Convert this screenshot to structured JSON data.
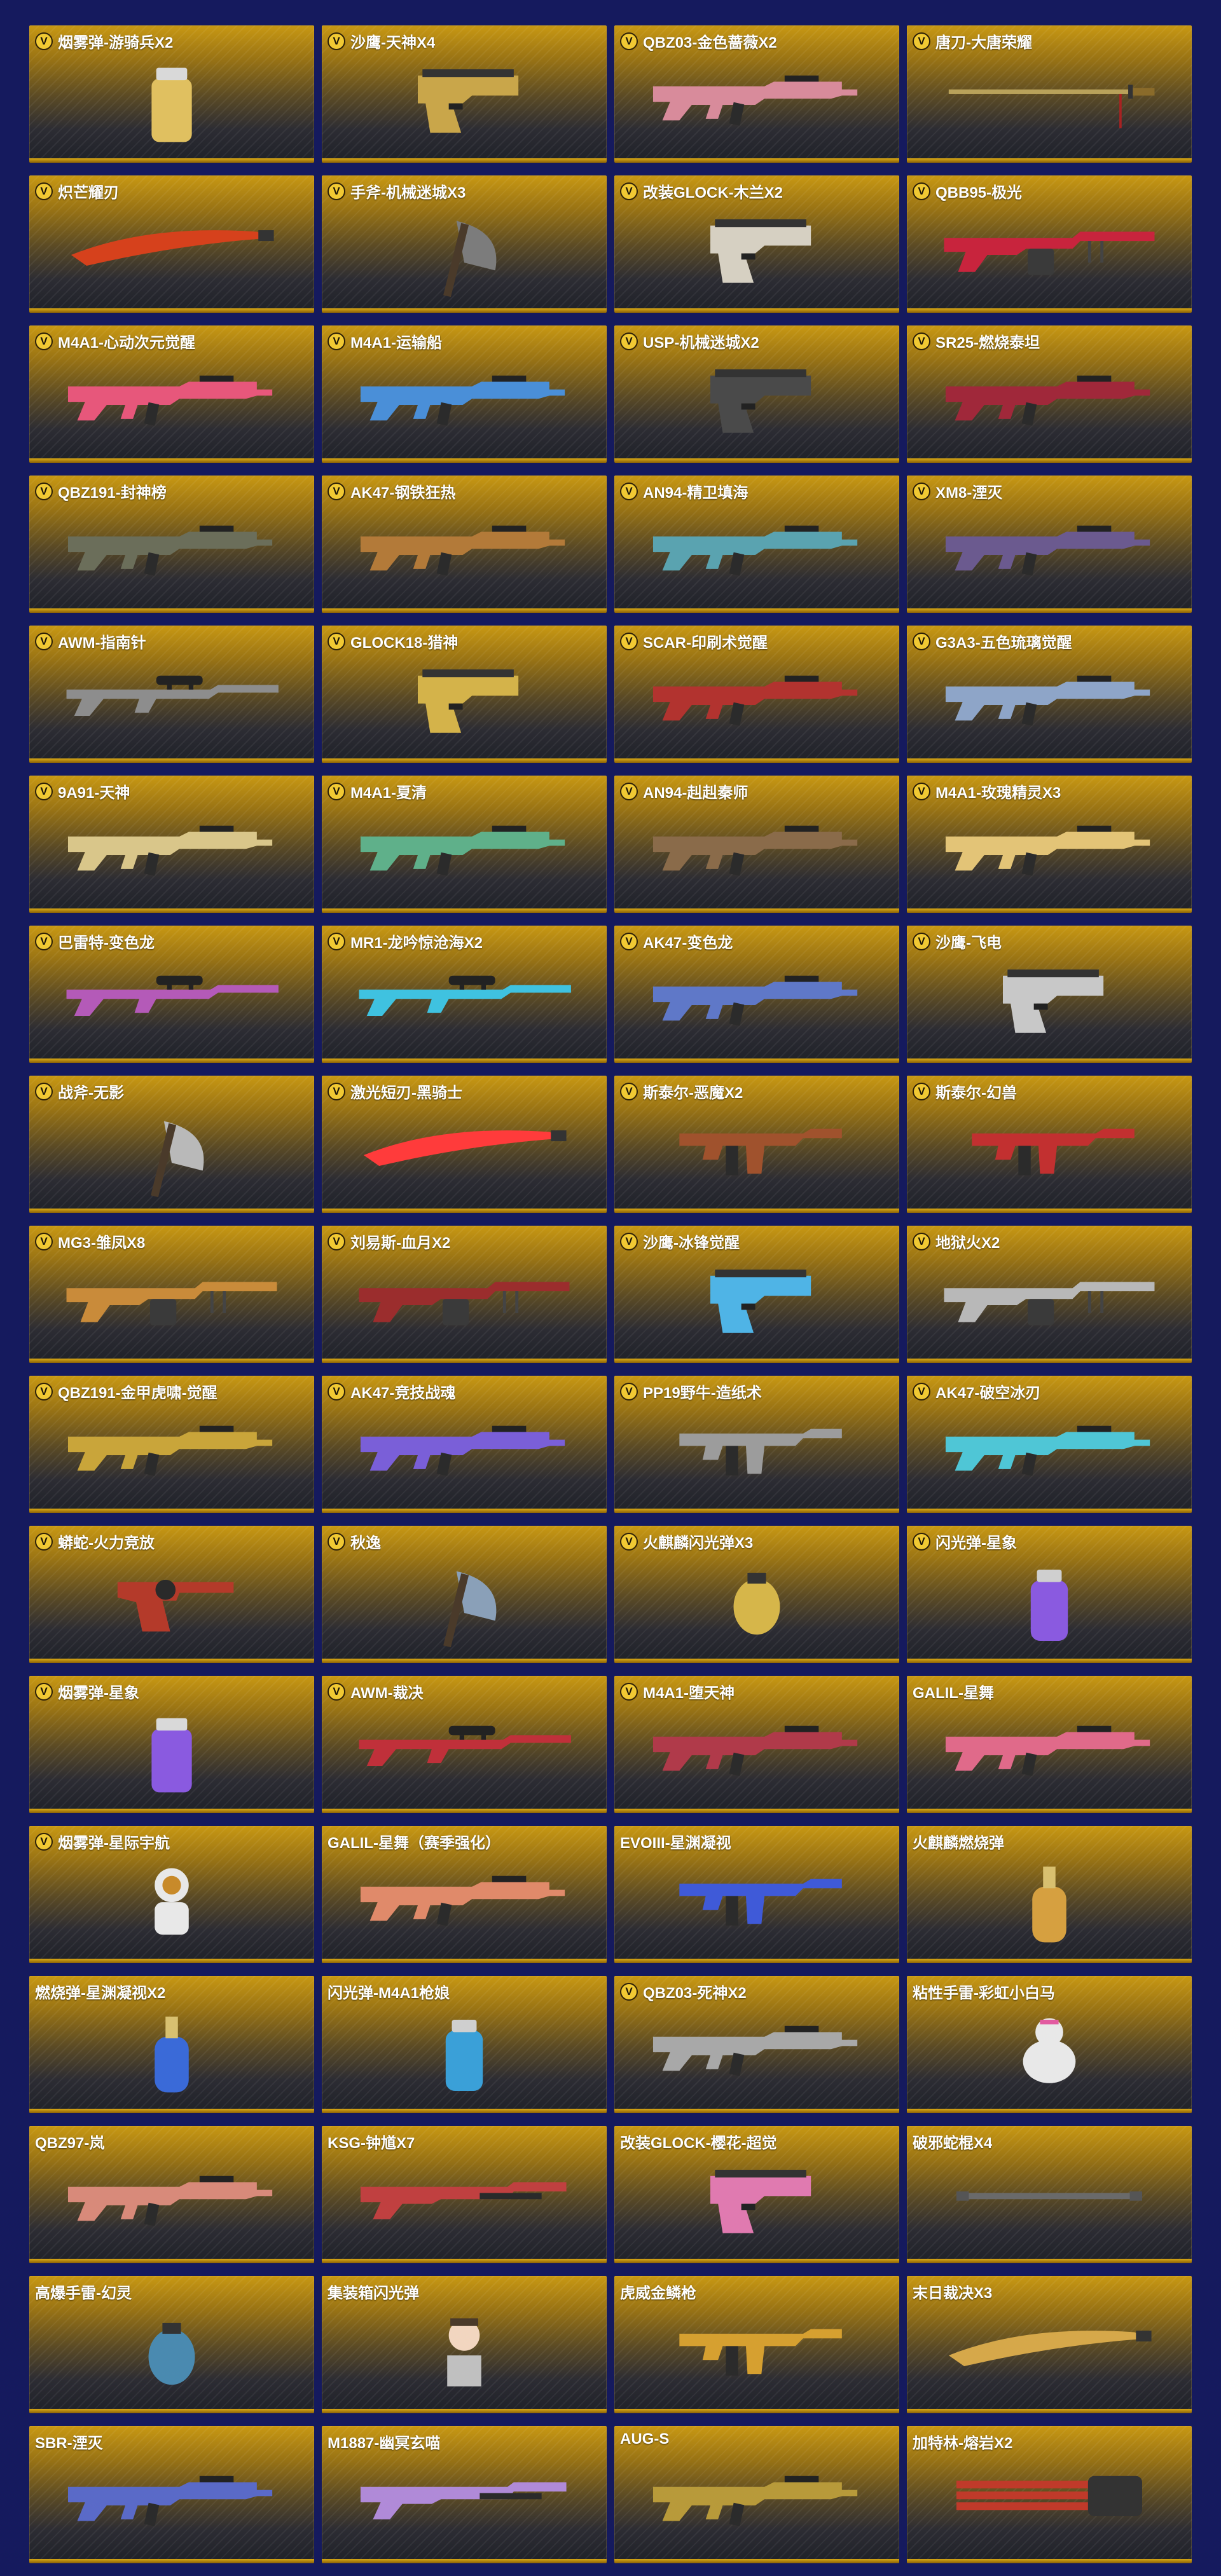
{
  "colors": {
    "page_background": "#151a5e",
    "card_gold": "#c89813",
    "card_dark": "#1f2128",
    "badge": "#f1c933"
  },
  "badge_letter": "V",
  "items": [
    {
      "name": "烟雾弹-游骑兵X2",
      "vip": true,
      "icon": "smoke-grenade",
      "color": "#e0c060"
    },
    {
      "name": "沙鹰-天神X4",
      "vip": true,
      "icon": "pistol",
      "color": "#c9a64a"
    },
    {
      "name": "QBZ03-金色蔷薇X2",
      "vip": true,
      "icon": "rifle",
      "color": "#d88b9b"
    },
    {
      "name": "唐刀-大唐荣耀",
      "vip": true,
      "icon": "sword",
      "color": "#b9a25a"
    },
    {
      "name": "炽芒耀刃",
      "vip": true,
      "icon": "blade",
      "color": "#d6411c"
    },
    {
      "name": "手斧-机械迷城X3",
      "vip": true,
      "icon": "axe",
      "color": "#7c7c7c"
    },
    {
      "name": "改装GLOCK-木兰X2",
      "vip": true,
      "icon": "pistol",
      "color": "#d6d0c2"
    },
    {
      "name": "QBB95-极光",
      "vip": true,
      "icon": "machinegun",
      "color": "#c8243d"
    },
    {
      "name": "M4A1-心动次元觉醒",
      "vip": true,
      "icon": "rifle",
      "color": "#e7577b"
    },
    {
      "name": "M4A1-运输船",
      "vip": true,
      "icon": "rifle",
      "color": "#4a8fd8"
    },
    {
      "name": "USP-机械迷城X2",
      "vip": true,
      "icon": "pistol",
      "color": "#4a4a4a"
    },
    {
      "name": "SR25-燃烧泰坦",
      "vip": true,
      "icon": "rifle",
      "color": "#a0283a"
    },
    {
      "name": "QBZ191-封神榜",
      "vip": true,
      "icon": "rifle",
      "color": "#6b6e5a"
    },
    {
      "name": "AK47-钢铁狂热",
      "vip": true,
      "icon": "rifle",
      "color": "#b37a39"
    },
    {
      "name": "AN94-精卫填海",
      "vip": true,
      "icon": "rifle",
      "color": "#5aa3b0"
    },
    {
      "name": "XM8-湮灭",
      "vip": true,
      "icon": "rifle",
      "color": "#6b5a8f"
    },
    {
      "name": "AWM-指南针",
      "vip": true,
      "icon": "sniper",
      "color": "#8d8d8d"
    },
    {
      "name": "GLOCK18-猎神",
      "vip": true,
      "icon": "pistol",
      "color": "#d4b34a"
    },
    {
      "name": "SCAR-印刷术觉醒",
      "vip": true,
      "icon": "rifle",
      "color": "#b2332f"
    },
    {
      "name": "G3A3-五色琉璃觉醒",
      "vip": true,
      "icon": "rifle",
      "color": "#8ea5c8"
    },
    {
      "name": "9A91-天神",
      "vip": true,
      "icon": "rifle",
      "color": "#d9c68a"
    },
    {
      "name": "M4A1-夏清",
      "vip": true,
      "icon": "rifle",
      "color": "#5fb08a"
    },
    {
      "name": "AN94-赳赳秦师",
      "vip": true,
      "icon": "rifle",
      "color": "#8a6b4a"
    },
    {
      "name": "M4A1-玫瑰精灵X3",
      "vip": true,
      "icon": "rifle",
      "color": "#e3c477"
    },
    {
      "name": "巴雷特-变色龙",
      "vip": true,
      "icon": "sniper",
      "color": "#b45ab8"
    },
    {
      "name": "MR1-龙吟惊沧海X2",
      "vip": true,
      "icon": "sniper",
      "color": "#3fc2e0"
    },
    {
      "name": "AK47-变色龙",
      "vip": true,
      "icon": "rifle",
      "color": "#5f78c8"
    },
    {
      "name": "沙鹰-飞电",
      "vip": true,
      "icon": "pistol",
      "color": "#c8c8c8"
    },
    {
      "name": "战斧-无影",
      "vip": true,
      "icon": "axe",
      "color": "#b9b9b9"
    },
    {
      "name": "激光短刃-黑骑士",
      "vip": true,
      "icon": "blade",
      "color": "#ff3b3b"
    },
    {
      "name": "斯泰尔-恶魔X2",
      "vip": true,
      "icon": "smg",
      "color": "#a0522d"
    },
    {
      "name": "斯泰尔-幻兽",
      "vip": true,
      "icon": "smg",
      "color": "#c23030"
    },
    {
      "name": "MG3-雏凤X8",
      "vip": true,
      "icon": "machinegun",
      "color": "#c98b3a"
    },
    {
      "name": "刘易斯-血月X2",
      "vip": true,
      "icon": "machinegun",
      "color": "#9b2d2d"
    },
    {
      "name": "沙鹰-冰锋觉醒",
      "vip": true,
      "icon": "pistol",
      "color": "#4fb4e6"
    },
    {
      "name": "地狱火X2",
      "vip": true,
      "icon": "machinegun",
      "color": "#b8b8b8"
    },
    {
      "name": "QBZ191-金甲虎啸-觉醒",
      "vip": true,
      "icon": "rifle",
      "color": "#c9a53a"
    },
    {
      "name": "AK47-竞技战魂",
      "vip": true,
      "icon": "rifle",
      "color": "#7a5fd8"
    },
    {
      "name": "PP19野牛-造纸术",
      "vip": true,
      "icon": "smg",
      "color": "#9c9c9c"
    },
    {
      "name": "AK47-破空冰刃",
      "vip": true,
      "icon": "rifle",
      "color": "#4fc6d6"
    },
    {
      "name": "蟒蛇-火力竞放",
      "vip": true,
      "icon": "revolver",
      "color": "#b43a2a"
    },
    {
      "name": "秋逸",
      "vip": true,
      "icon": "axe",
      "color": "#8aa0b8"
    },
    {
      "name": "火麒麟闪光弹X3",
      "vip": true,
      "icon": "grenade",
      "color": "#d6b64a"
    },
    {
      "name": "闪光弹-星象",
      "vip": true,
      "icon": "flash-grenade",
      "color": "#8a5ae0"
    },
    {
      "name": "烟雾弹-星象",
      "vip": true,
      "icon": "smoke-grenade",
      "color": "#8a5ae0"
    },
    {
      "name": "AWM-裁决",
      "vip": true,
      "icon": "sniper",
      "color": "#c0303a"
    },
    {
      "name": "M4A1-堕天神",
      "vip": true,
      "icon": "rifle",
      "color": "#b03a4a"
    },
    {
      "name": "GALIL-星舞",
      "vip": false,
      "icon": "rifle",
      "color": "#e06a8a"
    },
    {
      "name": "烟雾弹-星际宇航",
      "vip": true,
      "icon": "astronaut",
      "color": "#e8e8e8"
    },
    {
      "name": "GALIL-星舞（赛季强化）",
      "vip": false,
      "icon": "rifle",
      "color": "#e08a6a"
    },
    {
      "name": "EVOIII-星渊凝视",
      "vip": false,
      "icon": "smg",
      "color": "#3f5ad8"
    },
    {
      "name": "火麒麟燃烧弹",
      "vip": false,
      "icon": "molotov",
      "color": "#d6a040"
    },
    {
      "name": "燃烧弹-星渊凝视X2",
      "vip": false,
      "icon": "molotov",
      "color": "#3a6ad8"
    },
    {
      "name": "闪光弹-M4A1枪娘",
      "vip": false,
      "icon": "flash-grenade",
      "color": "#3aa0d8"
    },
    {
      "name": "QBZ03-死神X2",
      "vip": true,
      "icon": "rifle",
      "color": "#a8a8a8"
    },
    {
      "name": "粘性手雷-彩虹小白马",
      "vip": false,
      "icon": "mascot",
      "color": "#e8e8e8"
    },
    {
      "name": "QBZ97-岚",
      "vip": false,
      "icon": "rifle",
      "color": "#d88a7a"
    },
    {
      "name": "KSG-钟馗X7",
      "vip": false,
      "icon": "shotgun",
      "color": "#c04040"
    },
    {
      "name": "改装GLOCK-樱花-超觉",
      "vip": false,
      "icon": "pistol",
      "color": "#e07ab0"
    },
    {
      "name": "破邪蛇棍X4",
      "vip": false,
      "icon": "staff",
      "color": "#6a6a6a"
    },
    {
      "name": "高爆手雷-幻灵",
      "vip": false,
      "icon": "grenade",
      "color": "#4a8ab0"
    },
    {
      "name": "集装箱闪光弹",
      "vip": false,
      "icon": "doll",
      "color": "#c0c0c0"
    },
    {
      "name": "虎威金鳞枪",
      "vip": false,
      "icon": "smg",
      "color": "#d6a030"
    },
    {
      "name": "末日裁决X3",
      "vip": false,
      "icon": "blade",
      "color": "#d6a84a"
    },
    {
      "name": "SBR-湮灭",
      "vip": false,
      "icon": "rifle",
      "color": "#5a6ac8"
    },
    {
      "name": "M1887-幽冥玄喵",
      "vip": false,
      "icon": "shotgun",
      "color": "#b08ad8"
    },
    {
      "name": "AUG-S",
      "vip": false,
      "icon": "rifle",
      "color": "#b89a3a"
    },
    {
      "name": "加特林-熔岩X2",
      "vip": false,
      "icon": "gatling",
      "color": "#c03a2a"
    }
  ]
}
